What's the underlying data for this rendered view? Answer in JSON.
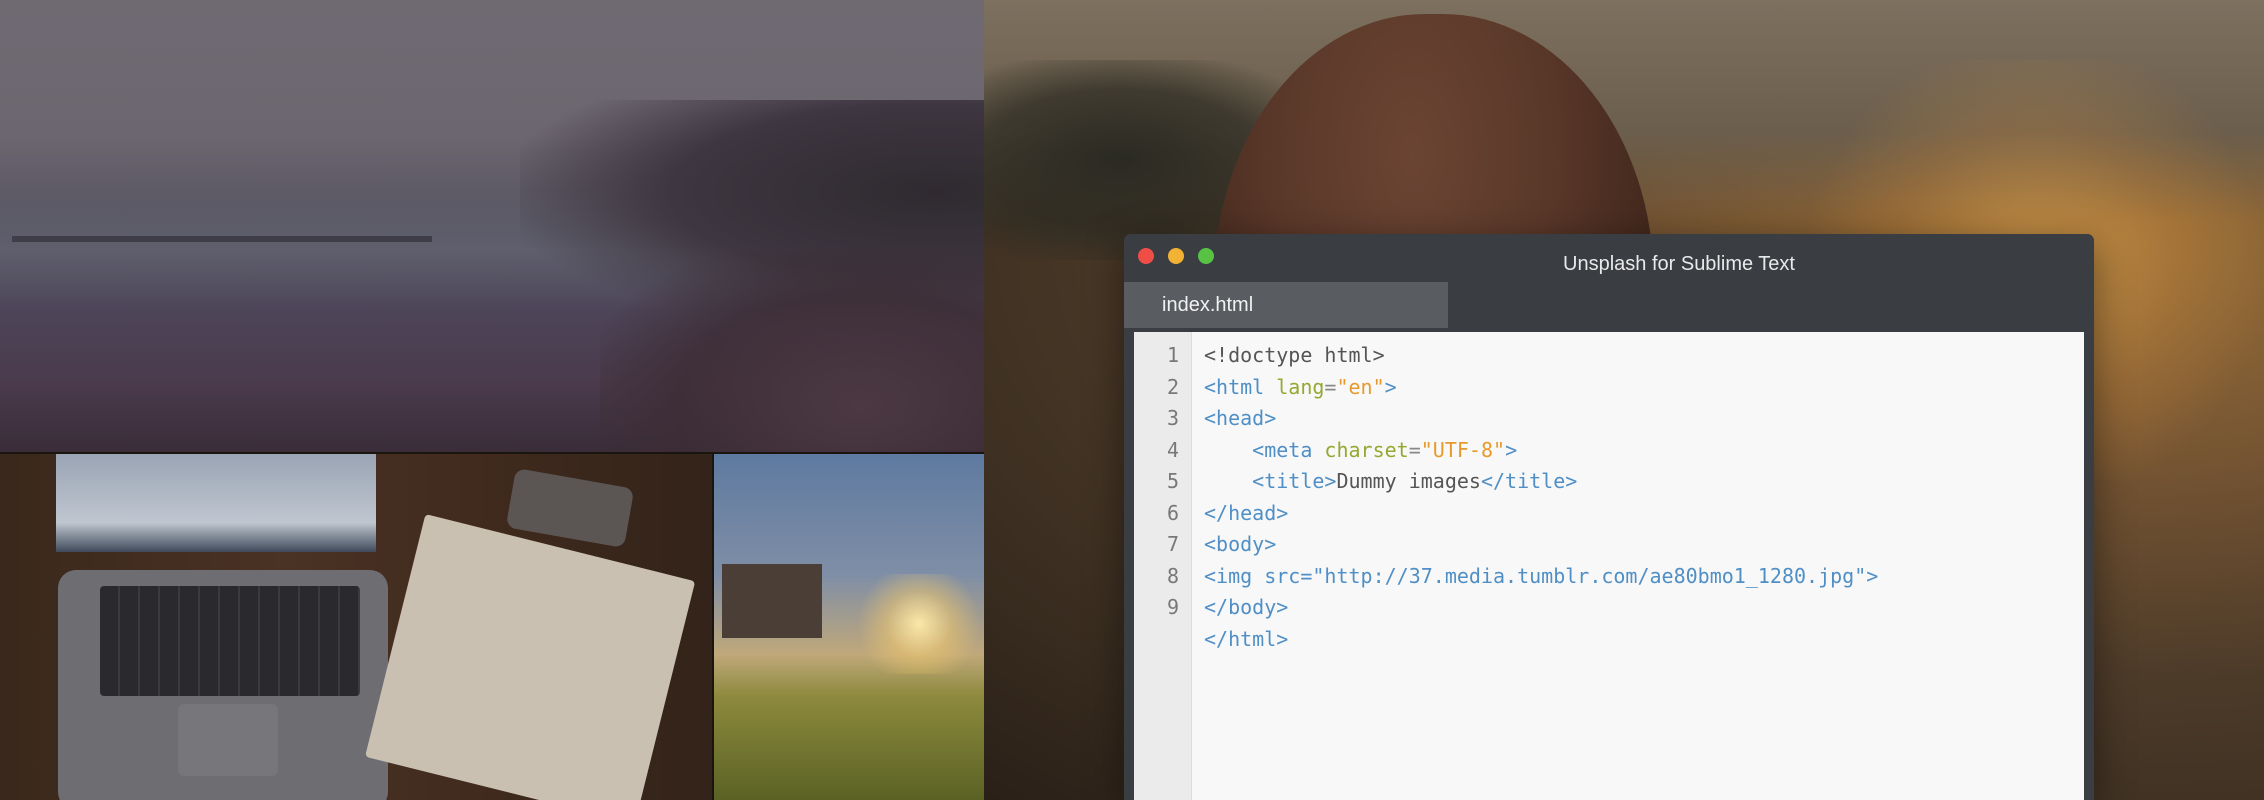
{
  "window": {
    "title": "Unsplash for Sublime Text",
    "controls": [
      "close",
      "minimize",
      "zoom"
    ],
    "tab": {
      "label": "index.html"
    }
  },
  "editor": {
    "line_numbers": [
      "1",
      "2",
      "3",
      "4",
      "5",
      "6",
      "7",
      "8",
      "9"
    ],
    "lines": [
      [
        {
          "t": "<!doctype html>",
          "c": "plain"
        }
      ],
      [
        {
          "t": "<html ",
          "c": "tag"
        },
        {
          "t": "lang",
          "c": "attr"
        },
        {
          "t": "=",
          "c": "punct"
        },
        {
          "t": "\"en\"",
          "c": "str"
        },
        {
          "t": ">",
          "c": "tag"
        }
      ],
      [
        {
          "t": "<head>",
          "c": "tag"
        }
      ],
      [
        {
          "t": "    <meta ",
          "c": "tag"
        },
        {
          "t": "charset",
          "c": "attr"
        },
        {
          "t": "=",
          "c": "punct"
        },
        {
          "t": "\"UTF-8\"",
          "c": "str"
        },
        {
          "t": ">",
          "c": "tag"
        }
      ],
      [
        {
          "t": "    <title>",
          "c": "tag"
        },
        {
          "t": "Dummy images",
          "c": "plain"
        },
        {
          "t": "</title>",
          "c": "tag"
        }
      ],
      [
        {
          "t": "</head>",
          "c": "tag"
        }
      ],
      [
        {
          "t": "<body>",
          "c": "tag"
        }
      ],
      [
        {
          "t": "<img src=\"http://37.media.tumblr.com/ae80bmo1_1280.jpg\">",
          "c": "tag"
        }
      ],
      [
        {
          "t": "</body>",
          "c": "tag"
        }
      ],
      [
        {
          "t": "</html>",
          "c": "tag"
        }
      ]
    ]
  },
  "colors": {
    "tag": "#4f8fc6",
    "attribute": "#95a832",
    "string": "#e79a2c",
    "plain": "#555555",
    "close": "#ee4e45",
    "minimize": "#f2b233",
    "zoom": "#57c244"
  }
}
